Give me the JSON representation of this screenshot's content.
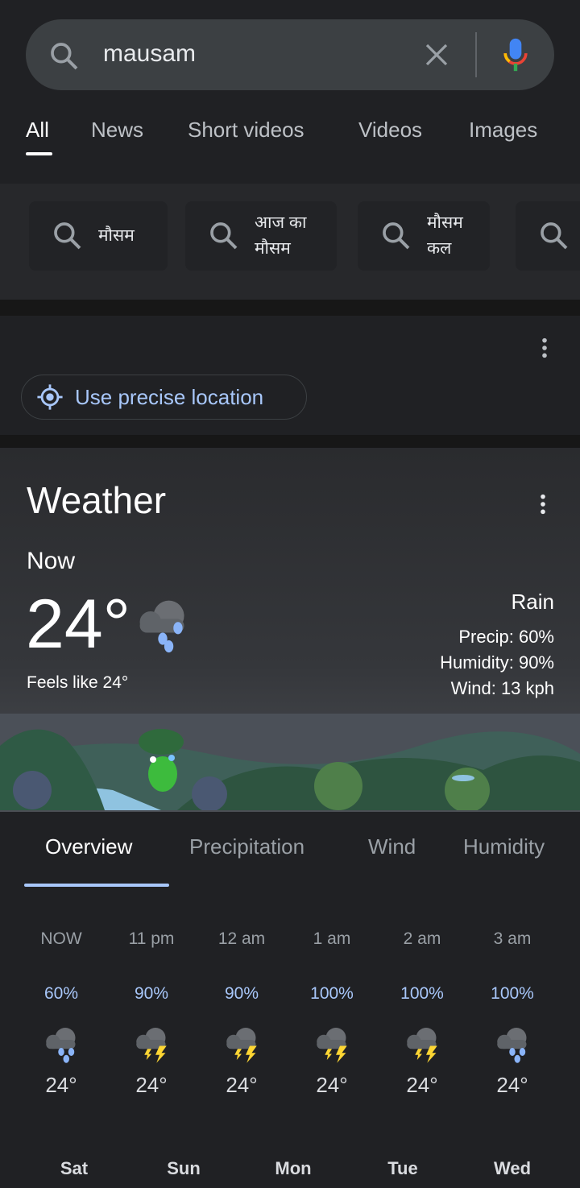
{
  "search": {
    "query": "mausam"
  },
  "tabs": [
    "All",
    "News",
    "Short videos",
    "Videos",
    "Images"
  ],
  "suggestions": [
    "मौसम",
    "आज का\nमौसम",
    "मौसम\nकल"
  ],
  "location": {
    "button": "Use precise location"
  },
  "weather": {
    "title": "Weather",
    "now_label": "Now",
    "temp": "24°",
    "feels": "Feels like 24°",
    "condition": "Rain",
    "precip": "Precip: 60%",
    "humidity": "Humidity: 90%",
    "wind": "Wind: 13 kph"
  },
  "weather_tabs": [
    "Overview",
    "Precipitation",
    "Wind",
    "Humidity"
  ],
  "hourly": [
    {
      "time": "NOW",
      "precip": "60%",
      "icon": "rain",
      "temp": "24°"
    },
    {
      "time": "11 pm",
      "precip": "90%",
      "icon": "thunderstorm",
      "temp": "24°"
    },
    {
      "time": "12 am",
      "precip": "90%",
      "icon": "thunderstorm",
      "temp": "24°"
    },
    {
      "time": "1 am",
      "precip": "100%",
      "icon": "thunderstorm",
      "temp": "24°"
    },
    {
      "time": "2 am",
      "precip": "100%",
      "icon": "thunderstorm",
      "temp": "24°"
    },
    {
      "time": "3 am",
      "precip": "100%",
      "icon": "rain",
      "temp": "24°"
    }
  ],
  "days": [
    "Sat",
    "Sun",
    "Mon",
    "Tue",
    "Wed"
  ],
  "colors": {
    "accent": "#a8c7fa",
    "background": "#202124"
  }
}
